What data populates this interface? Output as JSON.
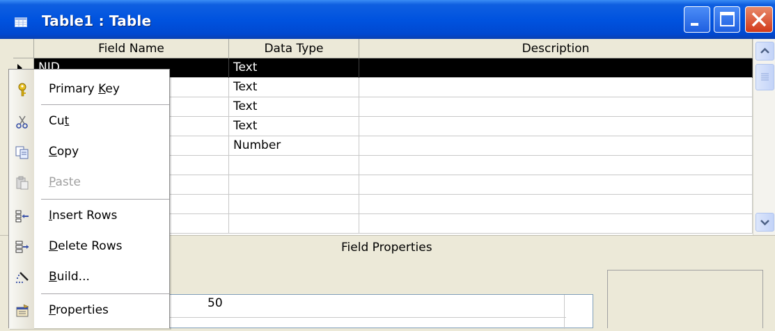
{
  "window": {
    "title": "Table1 : Table"
  },
  "columns": [
    "Field Name",
    "Data Type",
    "Description"
  ],
  "rows": [
    {
      "field": "NID",
      "type": "Text",
      "desc": ""
    },
    {
      "field": "",
      "type": "Text",
      "desc": ""
    },
    {
      "field": "",
      "type": "Text",
      "desc": ""
    },
    {
      "field": "",
      "type": "Text",
      "desc": ""
    },
    {
      "field": "",
      "type": "Number",
      "desc": ""
    },
    {
      "field": "",
      "type": "",
      "desc": ""
    },
    {
      "field": "",
      "type": "",
      "desc": ""
    },
    {
      "field": "",
      "type": "",
      "desc": ""
    },
    {
      "field": "",
      "type": "",
      "desc": ""
    }
  ],
  "field_properties": {
    "label": "Field Properties",
    "field_size_value": "50"
  },
  "context_menu": {
    "items": [
      {
        "label": "Primary Key",
        "underline": "K",
        "icon": "key-icon",
        "enabled": true
      },
      {
        "label": "Cut",
        "underline": "t",
        "icon": "scissors-icon",
        "enabled": true
      },
      {
        "label": "Copy",
        "underline": "C",
        "icon": "copy-icon",
        "enabled": true
      },
      {
        "label": "Paste",
        "underline": "P",
        "icon": "paste-icon",
        "enabled": false
      },
      {
        "label": "Insert Rows",
        "underline": "I",
        "icon": "insert-rows-icon",
        "enabled": true
      },
      {
        "label": "Delete Rows",
        "underline": "D",
        "icon": "delete-rows-icon",
        "enabled": true
      },
      {
        "label": "Build...",
        "underline": "B",
        "icon": "build-wand-icon",
        "enabled": true
      },
      {
        "label": "Properties",
        "underline": "P",
        "icon": "properties-icon",
        "enabled": true
      }
    ]
  },
  "colors": {
    "title_bar": "#0053DF",
    "selected_row": "#000000",
    "face": "#ECE9D8"
  }
}
